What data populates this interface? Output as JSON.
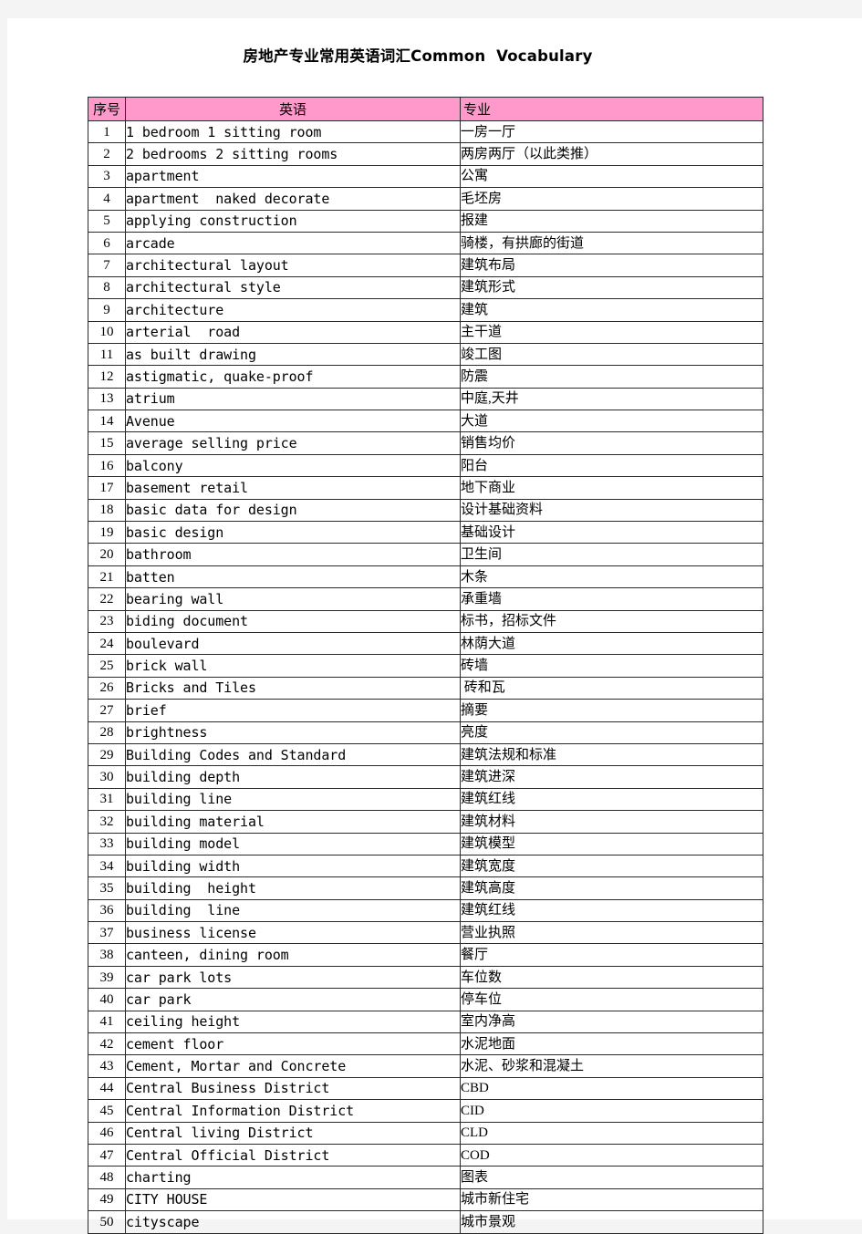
{
  "document": {
    "title": "房地产专业常用英语词汇Common  Vocabulary"
  },
  "table": {
    "header_background": "#ff99cc",
    "columns": [
      {
        "key": "index",
        "label": "序号"
      },
      {
        "key": "english",
        "label": "英语"
      },
      {
        "key": "chinese",
        "label": "专业"
      }
    ],
    "rows": [
      {
        "index": "1",
        "english": "1 bedroom 1 sitting room",
        "chinese": "一房一厅"
      },
      {
        "index": "2",
        "english": "2 bedrooms 2 sitting rooms",
        "chinese": "两房两厅（以此类推）"
      },
      {
        "index": "3",
        "english": "apartment",
        "chinese": "公寓"
      },
      {
        "index": "4",
        "english": "apartment  naked decorate",
        "chinese": "毛坯房"
      },
      {
        "index": "5",
        "english": "applying construction",
        "chinese": "报建"
      },
      {
        "index": "6",
        "english": "arcade",
        "chinese": "骑楼，有拱廊的街道"
      },
      {
        "index": "7",
        "english": "architectural layout",
        "chinese": "建筑布局"
      },
      {
        "index": "8",
        "english": "architectural style",
        "chinese": "建筑形式"
      },
      {
        "index": "9",
        "english": "architecture",
        "chinese": "建筑"
      },
      {
        "index": "10",
        "english": "arterial  road",
        "chinese": "主干道"
      },
      {
        "index": "11",
        "english": "as built drawing",
        "chinese": "竣工图"
      },
      {
        "index": "12",
        "english": "astigmatic, quake-proof",
        "chinese": "防震"
      },
      {
        "index": "13",
        "english": "atrium",
        "chinese": "中庭,天井"
      },
      {
        "index": "14",
        "english": "Avenue",
        "chinese": "大道"
      },
      {
        "index": "15",
        "english": "average selling price",
        "chinese": "销售均价"
      },
      {
        "index": "16",
        "english": "balcony",
        "chinese": "阳台"
      },
      {
        "index": "17",
        "english": "basement retail",
        "chinese": "地下商业"
      },
      {
        "index": "18",
        "english": "basic data for design",
        "chinese": "设计基础资料"
      },
      {
        "index": "19",
        "english": "basic design",
        "chinese": "基础设计"
      },
      {
        "index": "20",
        "english": "bathroom",
        "chinese": "卫生间"
      },
      {
        "index": "21",
        "english": "batten",
        "chinese": "木条"
      },
      {
        "index": "22",
        "english": "bearing wall",
        "chinese": "承重墙"
      },
      {
        "index": "23",
        "english": "biding document",
        "chinese": "标书，招标文件"
      },
      {
        "index": "24",
        "english": "boulevard",
        "chinese": "林荫大道"
      },
      {
        "index": "25",
        "english": "brick wall",
        "chinese": "砖墙"
      },
      {
        "index": "26",
        "english": "Bricks and Tiles",
        "chinese": " 砖和瓦"
      },
      {
        "index": "27",
        "english": "brief",
        "chinese": "摘要"
      },
      {
        "index": "28",
        "english": "brightness",
        "chinese": "亮度"
      },
      {
        "index": "29",
        "english": "Building Codes and Standard",
        "chinese": "建筑法规和标准"
      },
      {
        "index": "30",
        "english": "building depth",
        "chinese": "建筑进深"
      },
      {
        "index": "31",
        "english": "building line",
        "chinese": "建筑红线"
      },
      {
        "index": "32",
        "english": "building material",
        "chinese": "建筑材料"
      },
      {
        "index": "33",
        "english": "building model",
        "chinese": "建筑模型"
      },
      {
        "index": "34",
        "english": "building width",
        "chinese": "建筑宽度"
      },
      {
        "index": "35",
        "english": "building  height",
        "chinese": "建筑高度"
      },
      {
        "index": "36",
        "english": "building  line",
        "chinese": "建筑红线"
      },
      {
        "index": "37",
        "english": "business license",
        "chinese": "营业执照"
      },
      {
        "index": "38",
        "english": "canteen, dining room",
        "chinese": "餐厅"
      },
      {
        "index": "39",
        "english": "car park lots",
        "chinese": "车位数"
      },
      {
        "index": "40",
        "english": "car park",
        "chinese": "停车位"
      },
      {
        "index": "41",
        "english": "ceiling height",
        "chinese": "室内净高"
      },
      {
        "index": "42",
        "english": "cement floor",
        "chinese": "水泥地面"
      },
      {
        "index": "43",
        "english": "Cement, Mortar and Concrete",
        "chinese": "水泥、砂浆和混凝土"
      },
      {
        "index": "44",
        "english": "Central Business District",
        "chinese": "CBD"
      },
      {
        "index": "45",
        "english": "Central Information District",
        "chinese": "CID"
      },
      {
        "index": "46",
        "english": "Central living District",
        "chinese": "CLD"
      },
      {
        "index": "47",
        "english": "Central Official District",
        "chinese": "COD"
      },
      {
        "index": "48",
        "english": "charting",
        "chinese": "图表"
      },
      {
        "index": "49",
        "english": "CITY HOUSE",
        "chinese": "城市新住宅"
      },
      {
        "index": "50",
        "english": "cityscape",
        "chinese": "城市景观"
      }
    ]
  }
}
